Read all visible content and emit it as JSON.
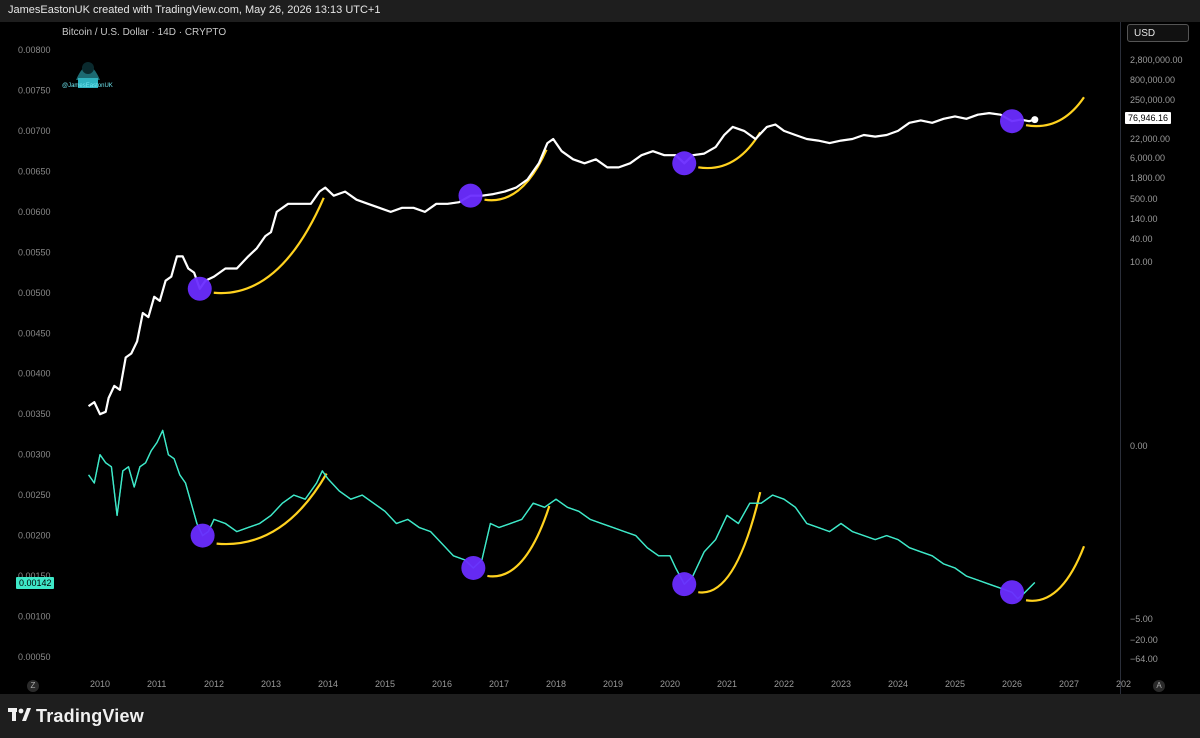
{
  "header": {
    "credit": "JamesEastonUK created with TradingView.com, May 26, 2026 13:13 UTC+1"
  },
  "legend": {
    "title": "Bitcoin / U.S. Dollar · 14D · CRYPTO"
  },
  "watermark": {
    "handle": "@JamesEastonUK"
  },
  "currency_button": {
    "label": "USD"
  },
  "scale_buttons": {
    "left": "Z",
    "right": "A"
  },
  "footer": {
    "brand": "TradingView"
  },
  "colors": {
    "price": "#ffffff",
    "oscillator": "#3ee8c8",
    "marker": "#6a2cff",
    "projection": "#ffd21f",
    "background": "#000000"
  },
  "chart_data": [
    {
      "type": "line",
      "series": [
        {
          "values": "log-scale BTC price (14D candles)"
        }
      ],
      "yaxis_right_ticks": [
        "2,800,000.00",
        "800,000.00",
        "250,000.00",
        "76,946.16",
        "22,000.00",
        "6,000.00",
        "1,800.00",
        "500.00",
        "140.00",
        "40.00",
        "10.00"
      ],
      "last_price_label": "76,946.16",
      "x_ticks": [
        "2010",
        "2011",
        "2012",
        "2013",
        "2014",
        "2015",
        "2016",
        "2017",
        "2018",
        "2019",
        "2020",
        "2021",
        "2022",
        "2023",
        "2024",
        "2025",
        "2026",
        "2027",
        "202"
      ],
      "points": [
        [
          2009.8,
          0.0036
        ],
        [
          2009.9,
          0.00365
        ],
        [
          2010.0,
          0.0035
        ],
        [
          2010.1,
          0.00353
        ],
        [
          2010.15,
          0.0037
        ],
        [
          2010.25,
          0.00385
        ],
        [
          2010.35,
          0.0038
        ],
        [
          2010.45,
          0.0042
        ],
        [
          2010.55,
          0.00425
        ],
        [
          2010.65,
          0.0044
        ],
        [
          2010.75,
          0.00475
        ],
        [
          2010.85,
          0.0047
        ],
        [
          2010.95,
          0.00495
        ],
        [
          2011.05,
          0.0049
        ],
        [
          2011.15,
          0.00515
        ],
        [
          2011.25,
          0.0052
        ],
        [
          2011.35,
          0.00545
        ],
        [
          2011.45,
          0.00545
        ],
        [
          2011.55,
          0.0053
        ],
        [
          2011.65,
          0.00525
        ],
        [
          2011.75,
          0.00505
        ],
        [
          2011.85,
          0.00515
        ],
        [
          2012.0,
          0.0052
        ],
        [
          2012.2,
          0.0053
        ],
        [
          2012.4,
          0.0053
        ],
        [
          2012.6,
          0.00545
        ],
        [
          2012.75,
          0.00555
        ],
        [
          2012.9,
          0.0057
        ],
        [
          2013.0,
          0.00575
        ],
        [
          2013.1,
          0.006
        ],
        [
          2013.3,
          0.0061
        ],
        [
          2013.5,
          0.0061
        ],
        [
          2013.7,
          0.0061
        ],
        [
          2013.85,
          0.00625
        ],
        [
          2013.95,
          0.0063
        ],
        [
          2014.1,
          0.0062
        ],
        [
          2014.3,
          0.00625
        ],
        [
          2014.5,
          0.00615
        ],
        [
          2014.7,
          0.0061
        ],
        [
          2014.9,
          0.00605
        ],
        [
          2015.1,
          0.006
        ],
        [
          2015.3,
          0.00605
        ],
        [
          2015.5,
          0.00605
        ],
        [
          2015.7,
          0.006
        ],
        [
          2015.9,
          0.0061
        ],
        [
          2016.1,
          0.0061
        ],
        [
          2016.3,
          0.00612
        ],
        [
          2016.5,
          0.0062
        ],
        [
          2016.7,
          0.0062
        ],
        [
          2016.9,
          0.00622
        ],
        [
          2017.1,
          0.00625
        ],
        [
          2017.3,
          0.0063
        ],
        [
          2017.5,
          0.0064
        ],
        [
          2017.7,
          0.0066
        ],
        [
          2017.85,
          0.00685
        ],
        [
          2017.95,
          0.0069
        ],
        [
          2018.1,
          0.00675
        ],
        [
          2018.3,
          0.00665
        ],
        [
          2018.5,
          0.0066
        ],
        [
          2018.7,
          0.00665
        ],
        [
          2018.9,
          0.00655
        ],
        [
          2019.1,
          0.00655
        ],
        [
          2019.3,
          0.0066
        ],
        [
          2019.5,
          0.0067
        ],
        [
          2019.7,
          0.00675
        ],
        [
          2019.9,
          0.0067
        ],
        [
          2020.1,
          0.0067
        ],
        [
          2020.25,
          0.0066
        ],
        [
          2020.4,
          0.0067
        ],
        [
          2020.6,
          0.00672
        ],
        [
          2020.8,
          0.0068
        ],
        [
          2020.95,
          0.00695
        ],
        [
          2021.1,
          0.00705
        ],
        [
          2021.3,
          0.007
        ],
        [
          2021.5,
          0.0069
        ],
        [
          2021.7,
          0.00705
        ],
        [
          2021.85,
          0.00708
        ],
        [
          2022.0,
          0.007
        ],
        [
          2022.2,
          0.00695
        ],
        [
          2022.4,
          0.0069
        ],
        [
          2022.6,
          0.00688
        ],
        [
          2022.8,
          0.00685
        ],
        [
          2023.0,
          0.00688
        ],
        [
          2023.2,
          0.0069
        ],
        [
          2023.4,
          0.00695
        ],
        [
          2023.6,
          0.00693
        ],
        [
          2023.8,
          0.00695
        ],
        [
          2024.0,
          0.007
        ],
        [
          2024.2,
          0.0071
        ],
        [
          2024.4,
          0.00713
        ],
        [
          2024.6,
          0.0071
        ],
        [
          2024.8,
          0.00715
        ],
        [
          2025.0,
          0.00718
        ],
        [
          2025.2,
          0.00715
        ],
        [
          2025.4,
          0.0072
        ],
        [
          2025.6,
          0.00722
        ],
        [
          2025.8,
          0.0072
        ],
        [
          2026.0,
          0.00712
        ],
        [
          2026.15,
          0.00714
        ],
        [
          2026.3,
          0.00712
        ],
        [
          2026.4,
          0.00714
        ]
      ]
    },
    {
      "type": "line",
      "series": [
        {
          "values": "oscillator"
        }
      ],
      "yaxis_left_ticks": [
        "0.00800",
        "0.00750",
        "0.00700",
        "0.00650",
        "0.00600",
        "0.00550",
        "0.00500",
        "0.00450",
        "0.00400",
        "0.00350",
        "0.00300",
        "0.00250",
        "0.00200",
        "0.00150",
        "0.00100",
        "0.00050"
      ],
      "current_value_label": "0.00142",
      "yaxis_right_ticks_lower": [
        "0.00",
        "−5.00",
        "−20.00",
        "−64.00"
      ],
      "points": [
        [
          2009.8,
          0.00275
        ],
        [
          2009.9,
          0.00265
        ],
        [
          2010.0,
          0.003
        ],
        [
          2010.1,
          0.0029
        ],
        [
          2010.2,
          0.00285
        ],
        [
          2010.3,
          0.00225
        ],
        [
          2010.4,
          0.0028
        ],
        [
          2010.5,
          0.00285
        ],
        [
          2010.6,
          0.0026
        ],
        [
          2010.7,
          0.00285
        ],
        [
          2010.8,
          0.0029
        ],
        [
          2010.9,
          0.00305
        ],
        [
          2011.0,
          0.00315
        ],
        [
          2011.1,
          0.0033
        ],
        [
          2011.2,
          0.003
        ],
        [
          2011.3,
          0.00295
        ],
        [
          2011.4,
          0.00275
        ],
        [
          2011.5,
          0.00265
        ],
        [
          2011.6,
          0.0024
        ],
        [
          2011.7,
          0.00215
        ],
        [
          2011.8,
          0.002
        ],
        [
          2011.9,
          0.00205
        ],
        [
          2012.0,
          0.0022
        ],
        [
          2012.2,
          0.00215
        ],
        [
          2012.4,
          0.00205
        ],
        [
          2012.6,
          0.0021
        ],
        [
          2012.8,
          0.00215
        ],
        [
          2013.0,
          0.00225
        ],
        [
          2013.2,
          0.0024
        ],
        [
          2013.4,
          0.0025
        ],
        [
          2013.6,
          0.00245
        ],
        [
          2013.8,
          0.00265
        ],
        [
          2013.9,
          0.0028
        ],
        [
          2014.0,
          0.0027
        ],
        [
          2014.2,
          0.00255
        ],
        [
          2014.4,
          0.00245
        ],
        [
          2014.6,
          0.0025
        ],
        [
          2014.8,
          0.0024
        ],
        [
          2015.0,
          0.0023
        ],
        [
          2015.2,
          0.00215
        ],
        [
          2015.4,
          0.0022
        ],
        [
          2015.6,
          0.0021
        ],
        [
          2015.8,
          0.00205
        ],
        [
          2016.0,
          0.0019
        ],
        [
          2016.2,
          0.00175
        ],
        [
          2016.4,
          0.0017
        ],
        [
          2016.55,
          0.0016
        ],
        [
          2016.7,
          0.0017
        ],
        [
          2016.85,
          0.00215
        ],
        [
          2017.0,
          0.0021
        ],
        [
          2017.2,
          0.00215
        ],
        [
          2017.4,
          0.0022
        ],
        [
          2017.6,
          0.0024
        ],
        [
          2017.8,
          0.00235
        ],
        [
          2018.0,
          0.00245
        ],
        [
          2018.2,
          0.00235
        ],
        [
          2018.4,
          0.0023
        ],
        [
          2018.6,
          0.0022
        ],
        [
          2018.8,
          0.00215
        ],
        [
          2019.0,
          0.0021
        ],
        [
          2019.2,
          0.00205
        ],
        [
          2019.4,
          0.002
        ],
        [
          2019.6,
          0.00185
        ],
        [
          2019.8,
          0.00175
        ],
        [
          2020.0,
          0.00175
        ],
        [
          2020.1,
          0.0016
        ],
        [
          2020.25,
          0.0014
        ],
        [
          2020.4,
          0.0015
        ],
        [
          2020.6,
          0.0018
        ],
        [
          2020.8,
          0.00195
        ],
        [
          2021.0,
          0.00225
        ],
        [
          2021.2,
          0.00215
        ],
        [
          2021.4,
          0.0024
        ],
        [
          2021.6,
          0.0024
        ],
        [
          2021.8,
          0.0025
        ],
        [
          2022.0,
          0.00245
        ],
        [
          2022.2,
          0.00235
        ],
        [
          2022.4,
          0.00215
        ],
        [
          2022.6,
          0.0021
        ],
        [
          2022.8,
          0.00205
        ],
        [
          2023.0,
          0.00215
        ],
        [
          2023.2,
          0.00205
        ],
        [
          2023.4,
          0.002
        ],
        [
          2023.6,
          0.00195
        ],
        [
          2023.8,
          0.002
        ],
        [
          2024.0,
          0.00195
        ],
        [
          2024.2,
          0.00185
        ],
        [
          2024.4,
          0.0018
        ],
        [
          2024.6,
          0.00175
        ],
        [
          2024.8,
          0.00165
        ],
        [
          2025.0,
          0.0016
        ],
        [
          2025.2,
          0.0015
        ],
        [
          2025.4,
          0.00145
        ],
        [
          2025.6,
          0.0014
        ],
        [
          2025.8,
          0.00135
        ],
        [
          2026.0,
          0.0013
        ],
        [
          2026.1,
          0.00122
        ],
        [
          2026.2,
          0.00128
        ],
        [
          2026.3,
          0.00135
        ],
        [
          2026.4,
          0.00142
        ]
      ]
    }
  ]
}
